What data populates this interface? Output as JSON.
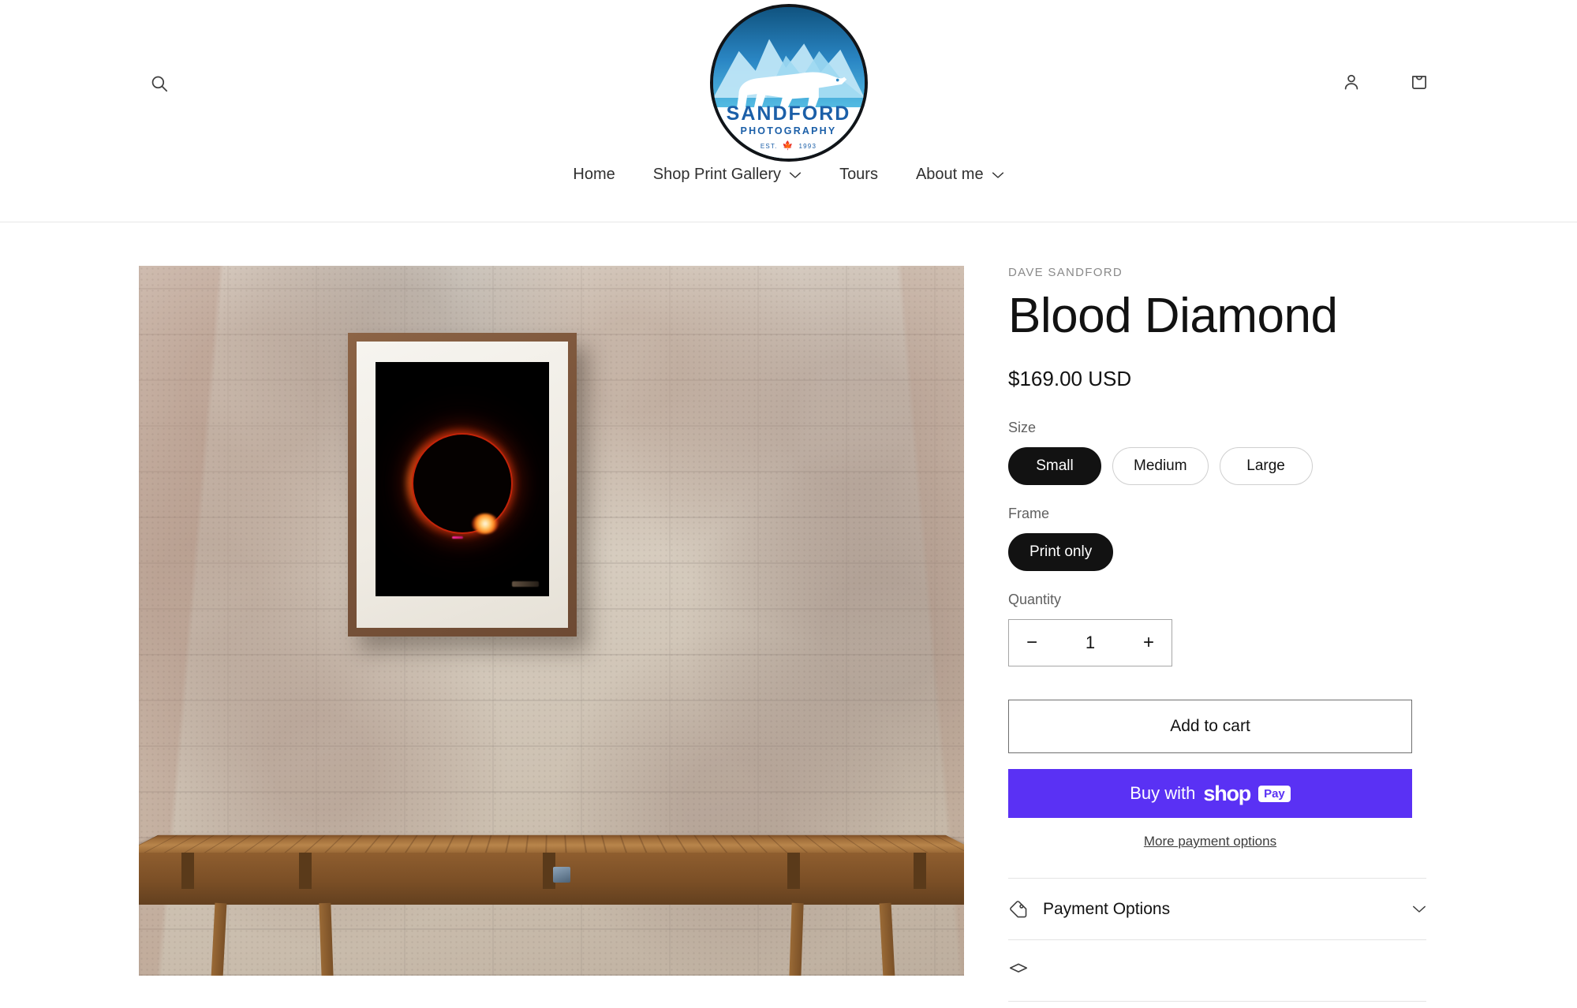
{
  "header": {
    "search_icon": "search-icon",
    "account_icon": "user-icon",
    "cart_icon": "shopping-bag-icon",
    "logo": {
      "name": "SANDFORD",
      "subtitle": "PHOTOGRAPHY",
      "est_left": "EST.",
      "est_right": "1993",
      "leaf": "maple-leaf-icon"
    }
  },
  "nav": {
    "items": [
      {
        "label": "Home",
        "has_dropdown": false
      },
      {
        "label": "Shop Print Gallery",
        "has_dropdown": true
      },
      {
        "label": "Tours",
        "has_dropdown": false
      },
      {
        "label": "About me",
        "has_dropdown": true
      }
    ],
    "chevron": "⌄"
  },
  "product": {
    "vendor": "DAVE SANDFORD",
    "title": "Blood Diamond",
    "price": "$169.00 USD",
    "media_alt": "Framed eclipse print hanging on a whitewashed brick wall above a rustic wooden table",
    "size": {
      "label": "Size",
      "options": [
        {
          "label": "Small",
          "selected": true
        },
        {
          "label": "Medium",
          "selected": false
        },
        {
          "label": "Large",
          "selected": false
        }
      ]
    },
    "frame": {
      "label": "Frame",
      "options": [
        {
          "label": "Print only",
          "selected": true
        }
      ]
    },
    "quantity": {
      "label": "Quantity",
      "value": "1",
      "decrease": "−",
      "increase": "+"
    },
    "add_to_cart": "Add to cart",
    "shop_pay": {
      "prefix": "Buy with",
      "brand": "shop",
      "badge": "Pay"
    },
    "more_payment_options": "More payment options",
    "accordions": [
      {
        "label": "Payment Options",
        "icon": "price-tag-icon",
        "expanded": false
      }
    ]
  },
  "colors": {
    "shop_pay_purple": "#5a31f4",
    "selected_pill": "#121212",
    "text_primary": "#121212",
    "text_muted": "#606060",
    "vendor_gray": "#8a8a8a",
    "border_light": "#e4e4e4",
    "logo_blue": "#1b5fa8"
  }
}
